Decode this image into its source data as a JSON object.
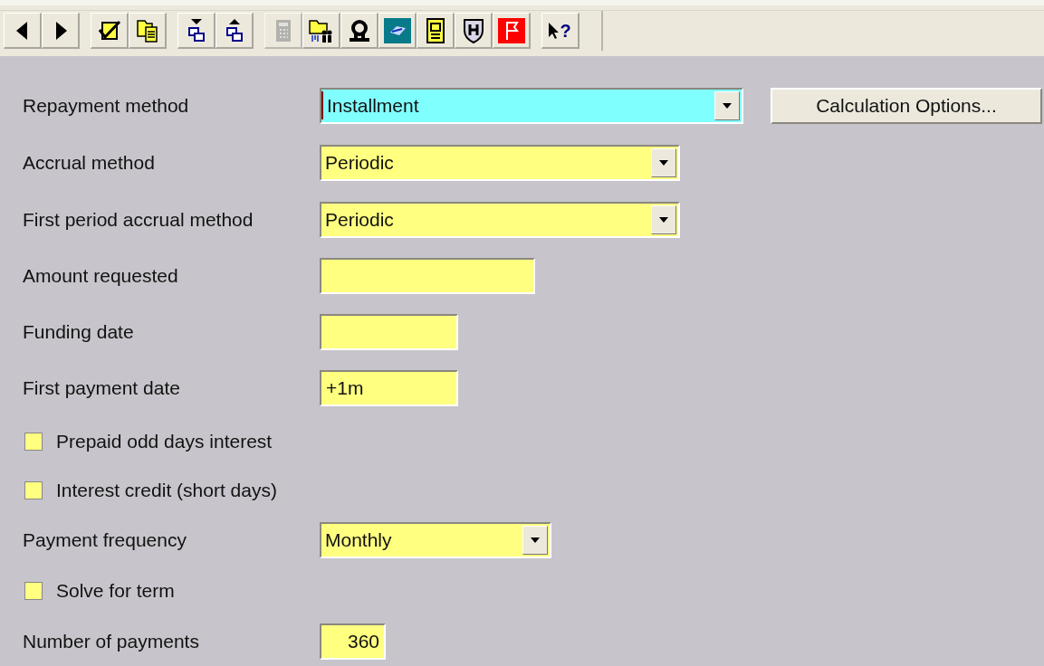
{
  "toolbar": [
    {
      "kind": "arrow-left",
      "disabled": false
    },
    {
      "kind": "arrow-right",
      "disabled": false
    },
    {
      "kind": "sep"
    },
    {
      "kind": "check-doc",
      "disabled": false
    },
    {
      "kind": "copy-folder",
      "disabled": false
    },
    {
      "kind": "sep"
    },
    {
      "kind": "move-down",
      "disabled": false
    },
    {
      "kind": "move-up",
      "disabled": false
    },
    {
      "kind": "sep"
    },
    {
      "kind": "calculator",
      "disabled": true
    },
    {
      "kind": "folder-people",
      "disabled": false
    },
    {
      "kind": "person",
      "disabled": false
    },
    {
      "kind": "blue-tile",
      "disabled": false
    },
    {
      "kind": "notebook",
      "disabled": false
    },
    {
      "kind": "shield",
      "disabled": false
    },
    {
      "kind": "flag",
      "disabled": false
    },
    {
      "kind": "sep"
    },
    {
      "kind": "help",
      "disabled": false,
      "label": "?"
    }
  ],
  "fields": [
    {
      "kind": "dropdown",
      "label": "Repayment method",
      "value": "Installment",
      "focused": true,
      "button": "Calculation Options..."
    },
    {
      "kind": "dropdown",
      "label": "Accrual method",
      "value": "Periodic",
      "focused": false
    },
    {
      "kind": "dropdown",
      "label": "First period accrual method",
      "value": "Periodic",
      "focused": false
    },
    {
      "kind": "text",
      "label": "Amount requested",
      "focused": false
    },
    {
      "kind": "text",
      "label": "Funding date",
      "focused": false
    },
    {
      "kind": "text",
      "label": "First payment date",
      "value": "+1m",
      "focused": false
    },
    {
      "kind": "checkbox",
      "label": "Prepaid odd days interest",
      "checked": false
    },
    {
      "kind": "checkbox",
      "label": "Interest credit (short days)",
      "checked": false
    },
    {
      "kind": "dropdown",
      "label": "Payment frequency",
      "value": "Monthly",
      "focused": false
    },
    {
      "kind": "checkbox",
      "label": "Solve for term",
      "checked": false
    },
    {
      "kind": "text",
      "label": "Number of payments",
      "value": "360",
      "focused": false
    }
  ]
}
